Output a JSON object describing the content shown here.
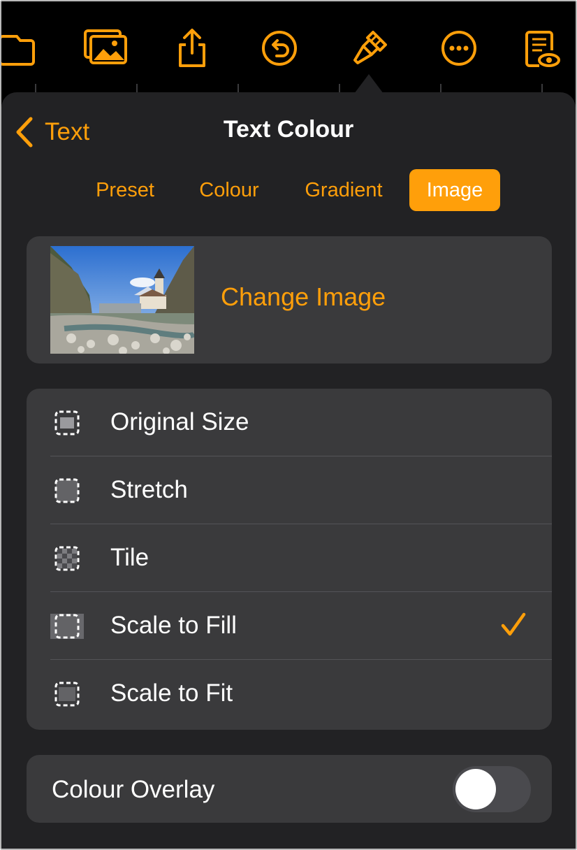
{
  "toolbar": {
    "icons": [
      "folder-icon",
      "media-icon",
      "share-icon",
      "undo-icon",
      "paintbrush-icon",
      "more-icon",
      "document-view-icon"
    ],
    "accent": "#ff9f0a"
  },
  "nav": {
    "back_label": "Text",
    "title": "Text Colour"
  },
  "tabs": [
    {
      "label": "Preset",
      "active": false
    },
    {
      "label": "Colour",
      "active": false
    },
    {
      "label": "Gradient",
      "active": false
    },
    {
      "label": "Image",
      "active": true
    }
  ],
  "image_card": {
    "change_label": "Change Image"
  },
  "fill_options": [
    {
      "label": "Original Size",
      "icon": "original-size-icon",
      "selected": false
    },
    {
      "label": "Stretch",
      "icon": "stretch-icon",
      "selected": false
    },
    {
      "label": "Tile",
      "icon": "tile-icon",
      "selected": false
    },
    {
      "label": "Scale to Fill",
      "icon": "scale-to-fill-icon",
      "selected": true
    },
    {
      "label": "Scale to Fit",
      "icon": "scale-to-fit-icon",
      "selected": false
    }
  ],
  "overlay": {
    "label": "Colour Overlay",
    "on": false
  },
  "colors": {
    "accent": "#ff9f0a",
    "panel": "#222224",
    "card": "#3a3a3c"
  }
}
